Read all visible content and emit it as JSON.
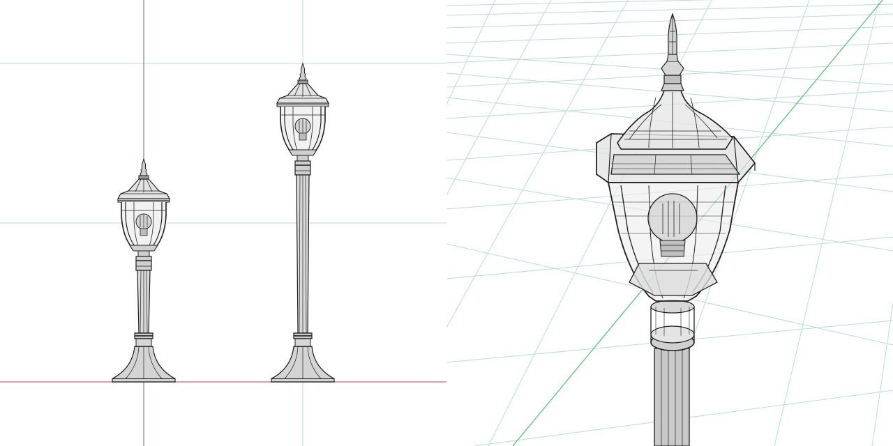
{
  "views": [
    {
      "name": "orthographic-front-view",
      "objects": [
        "short-lamp-post",
        "tall-lamp-post"
      ]
    },
    {
      "name": "perspective-close-up-view",
      "objects": [
        "lantern-head-close-up"
      ]
    }
  ],
  "colors": {
    "background": "#ffffff",
    "wire": "#1e1e1e",
    "fill": "#d9d9d9",
    "grid": "#b9dcd6",
    "axis_vertical": "#4a6fb0",
    "axis_horizontal": "#d0394b",
    "axis_green": "#49c46a"
  }
}
